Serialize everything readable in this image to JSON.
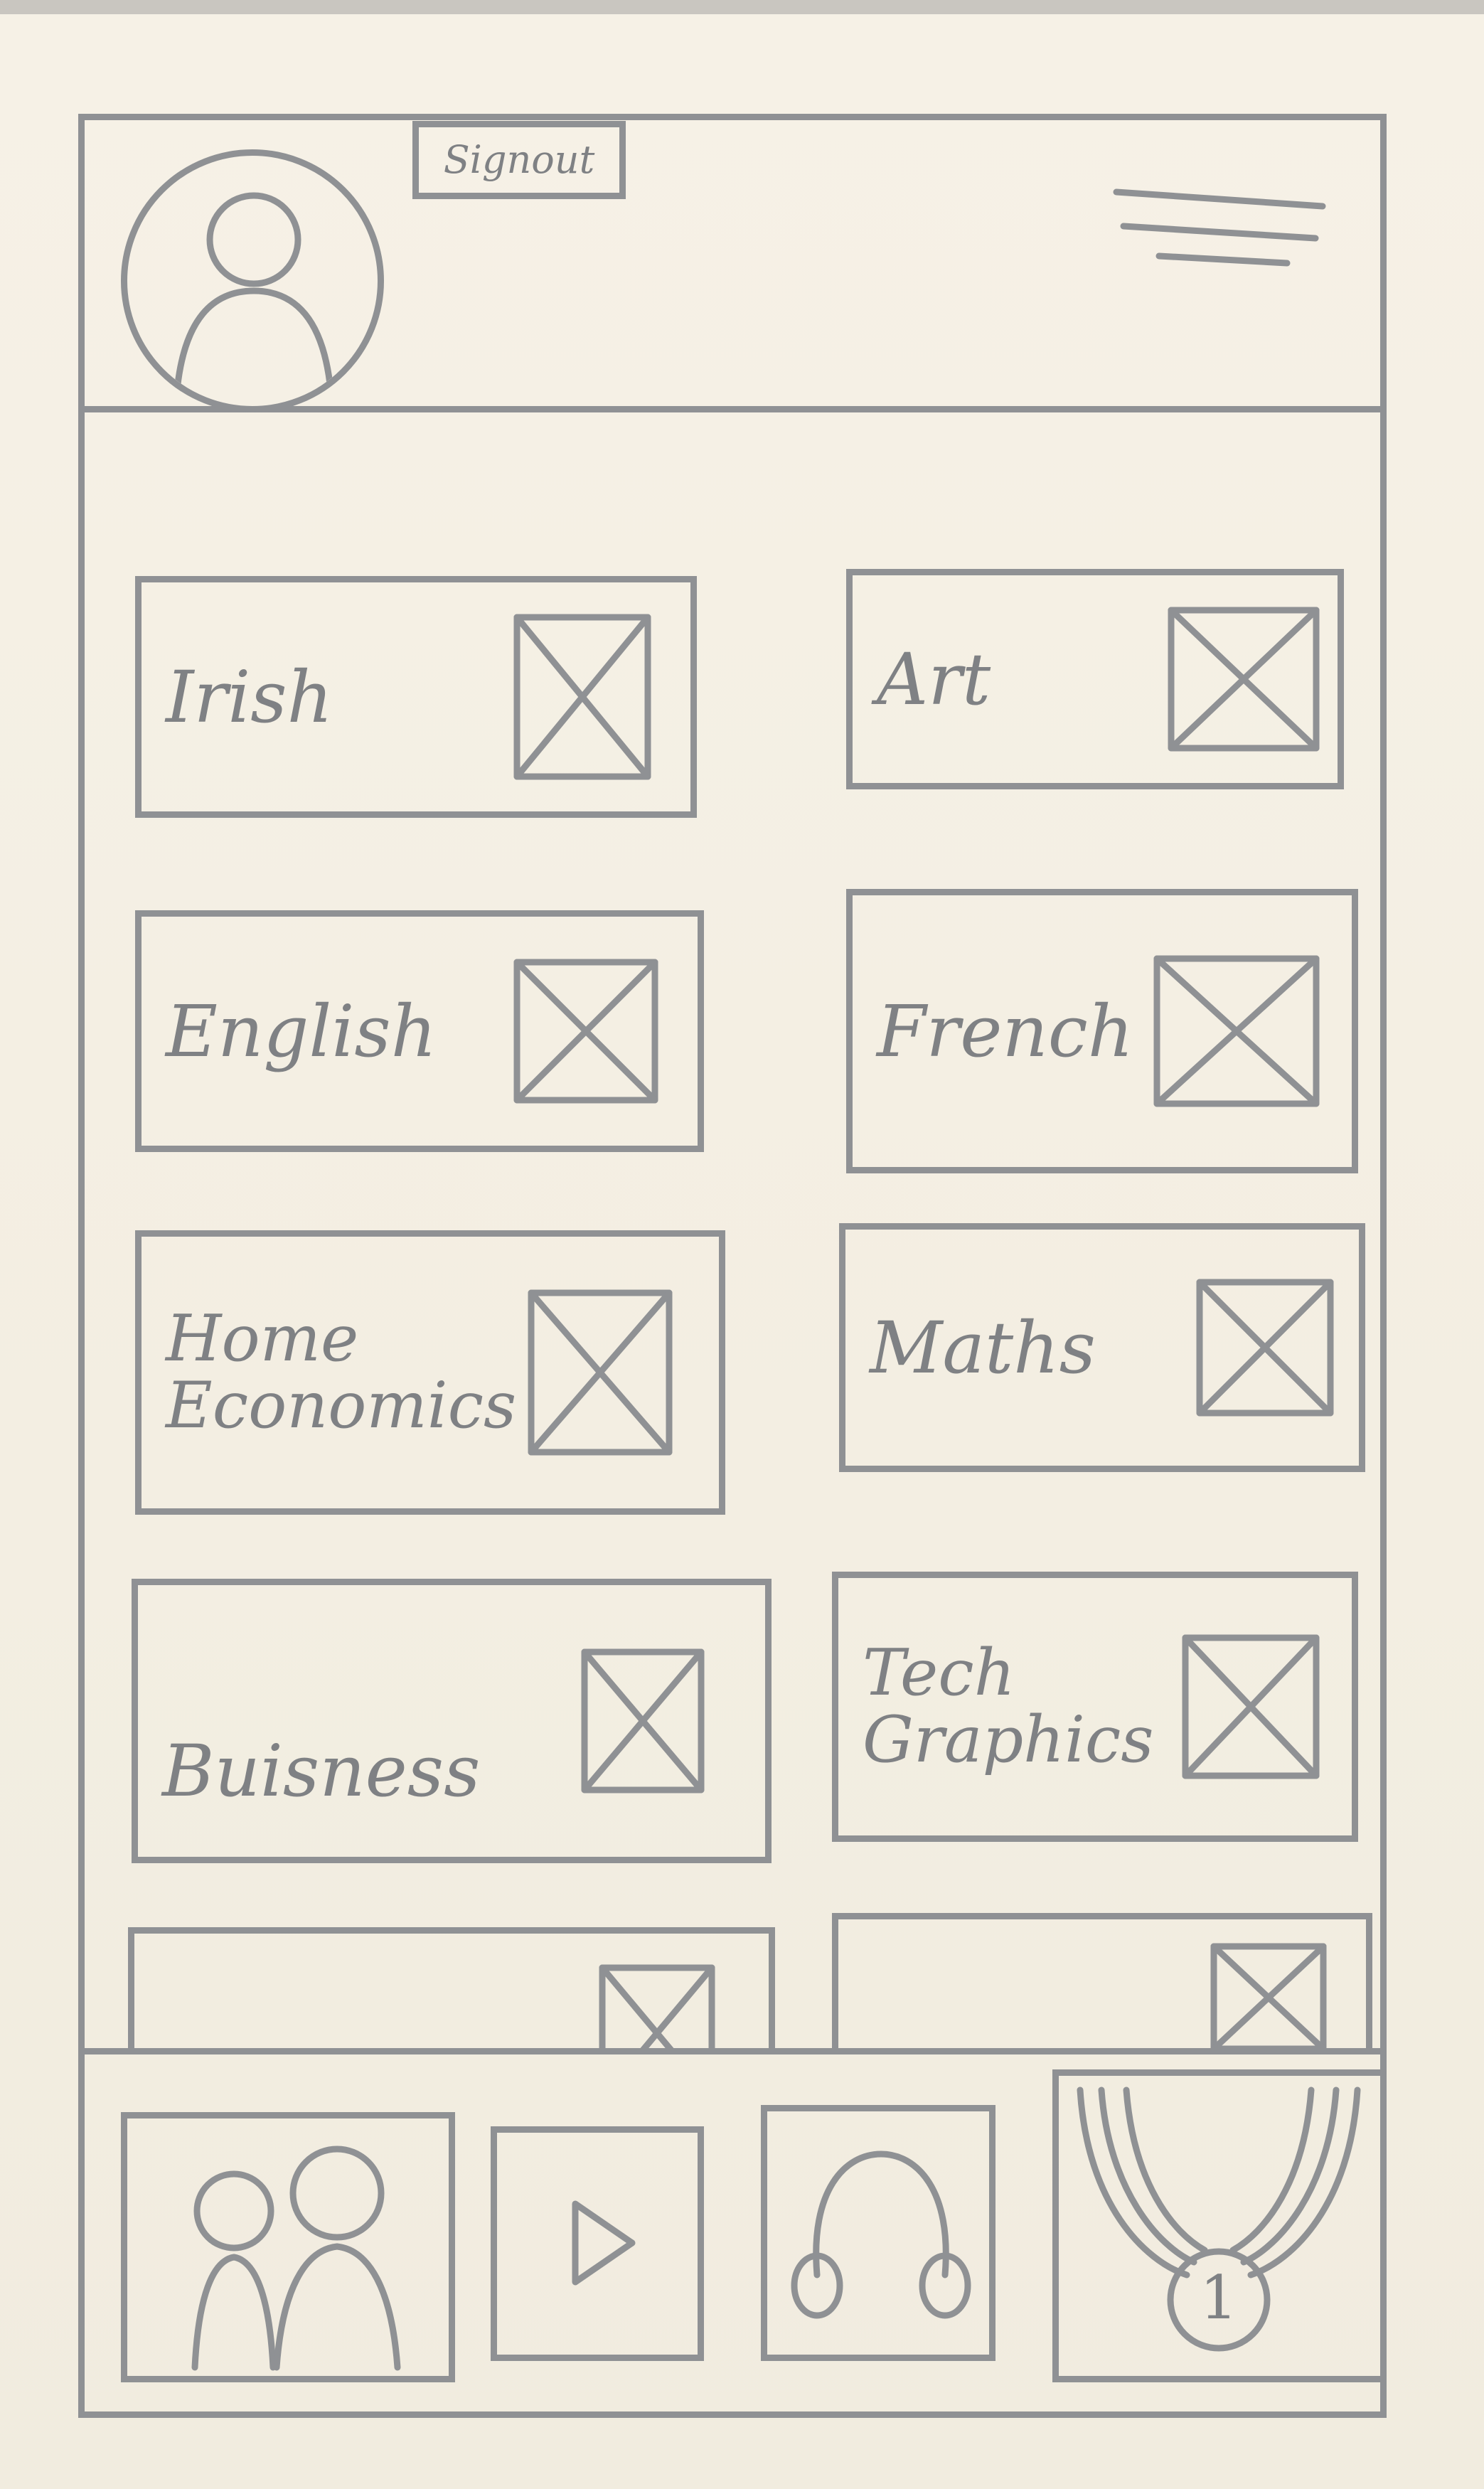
{
  "header": {
    "signout_label": "Signout",
    "avatar_icon": "user-avatar-icon",
    "menu_icon": "hamburger-menu-icon"
  },
  "subjects": [
    {
      "label": "Irish"
    },
    {
      "label": "Art"
    },
    {
      "label": "English"
    },
    {
      "label": "French"
    },
    {
      "label": "Home\nEconomics"
    },
    {
      "label": "Maths"
    },
    {
      "label": "Buisness"
    },
    {
      "label": "Tech\nGraphics"
    },
    {
      "label": ""
    },
    {
      "label": ""
    }
  ],
  "bottom_nav": {
    "items": [
      {
        "icon": "people-icon"
      },
      {
        "icon": "play-icon"
      },
      {
        "icon": "headphones-icon"
      },
      {
        "icon": "medal-icon",
        "badge": "1"
      }
    ]
  },
  "colors": {
    "ink": "#8f9194",
    "paper": "#f4efe4"
  }
}
